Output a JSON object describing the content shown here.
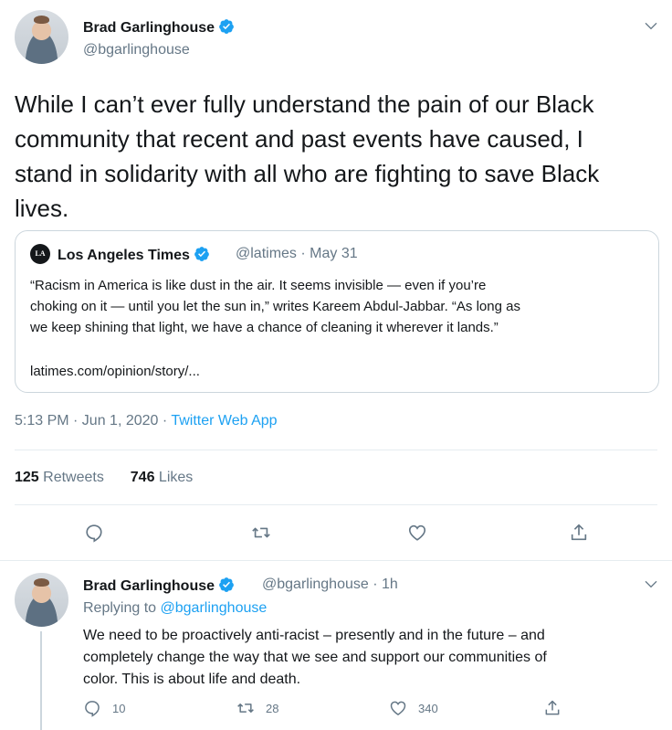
{
  "main_tweet": {
    "author_name": "Brad Garlinghouse",
    "author_handle": "@bgarlinghouse",
    "text": "While I can’t ever fully understand the pain of our Black\ncommunity that recent and past events have caused, I\nstand in solidarity with all who are fighting to save Black\nlives.",
    "quoted_tweet": {
      "logo_text": "LA Times",
      "author_name": "Los Angeles Times",
      "meta": "@latimes · May 31",
      "text": "“Racism in America is like dust in the air. It seems invisible — even if you’re\nchoking on it — until you let the sun in,” writes Kareem Abdul-Jabbar. “As long as\nwe keep shining that light, we have a chance of cleaning it wherever it lands.”",
      "link": "latimes.com/opinion/story/..."
    },
    "timestamp": "5:13 PM · Jun 1, 2020 · ",
    "source": "Twitter Web App",
    "retweet_count": "125",
    "retweet_label": "Retweets",
    "like_count": "746",
    "like_label": "Likes",
    "actions": [
      "reply-icon",
      "retweet-icon",
      "like-icon",
      "share-icon"
    ]
  },
  "reply_tweet": {
    "author_name": "Brad Garlinghouse",
    "meta": "@bgarlinghouse · 1h",
    "replying_to_label": "Replying to ",
    "replying_to_handle": "@bgarlinghouse",
    "text": "We need to be proactively anti-racist – presently and in the future – and\ncompletely change the way that we see and support our communities of\ncolor. This is about life and death.",
    "reply_count": "10",
    "retweet_count": "28",
    "like_count": "340"
  },
  "colors": {
    "accent": "#1da1f2",
    "secondary_text": "#657786",
    "border": "#e6ecf0"
  }
}
